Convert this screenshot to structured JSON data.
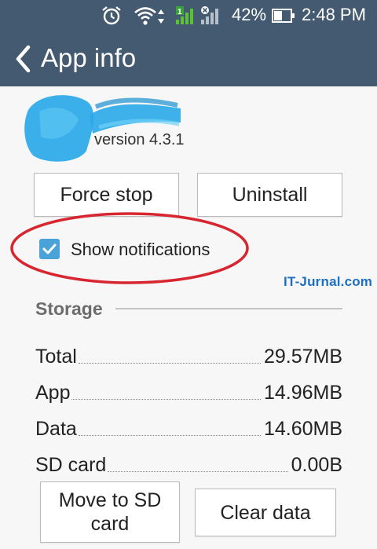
{
  "status_bar": {
    "battery_percent": "42%",
    "time": "2:48 PM",
    "icons": [
      "alarm-icon",
      "wifi-icon",
      "data-arrows-icon",
      "signal-1-icon",
      "signal-2-icon",
      "battery-icon"
    ]
  },
  "app_bar": {
    "title": "App info",
    "back_icon": "chevron-left-icon"
  },
  "app": {
    "version": "version 4.3.1"
  },
  "actions": {
    "force_stop": "Force stop",
    "uninstall": "Uninstall"
  },
  "notifications": {
    "label": "Show notifications",
    "checked": true
  },
  "watermark": "IT-Jurnal.com",
  "storage": {
    "title": "Storage",
    "rows": [
      {
        "label": "Total",
        "value": "29.57MB"
      },
      {
        "label": "App",
        "value": "14.96MB"
      },
      {
        "label": "Data",
        "value": "14.60MB"
      },
      {
        "label": "SD card",
        "value": "0.00B"
      }
    ],
    "move_button": "Move to SD card",
    "clear_button": "Clear data"
  },
  "colors": {
    "app_bar": "#445a70",
    "checkbox": "#4aa3d8",
    "annotation": "#d7262f",
    "watermark": "#1d6fc4"
  }
}
